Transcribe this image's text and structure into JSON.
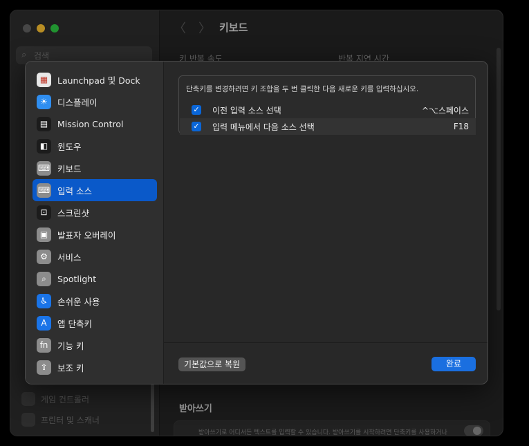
{
  "window": {
    "title": "키보드",
    "search_placeholder": "검색",
    "bg_sidebar_items": [
      "게임 컨트롤러",
      "프린터 및 스캐너"
    ],
    "col_headers": [
      "키 반복 속도",
      "반복 지연 시간"
    ],
    "section_title": "받아쓰기",
    "dictation_desc": "받아쓰기로 어디서든 텍스트를 입력할 수 있습니다. 받아쓰기를 시작하려면 단축키를 사용하거나"
  },
  "sheet": {
    "sidebar": [
      {
        "label": "Launchpad 및 Dock",
        "icon": "launchpad-icon",
        "color": "#e8e8e8",
        "glyph": "▦"
      },
      {
        "label": "디스플레이",
        "icon": "display-icon",
        "color": "#2f8ef0",
        "glyph": "☀"
      },
      {
        "label": "Mission Control",
        "icon": "mission-control-icon",
        "color": "#1c1c1c",
        "glyph": "▤"
      },
      {
        "label": "윈도우",
        "icon": "window-icon",
        "color": "#1c1c1c",
        "glyph": "◧"
      },
      {
        "label": "키보드",
        "icon": "keyboard-icon",
        "color": "#8c8c8c",
        "glyph": "⌨"
      },
      {
        "label": "입력 소스",
        "icon": "input-sources-icon",
        "color": "#8c8c8c",
        "glyph": "⌨"
      },
      {
        "label": "스크린샷",
        "icon": "screenshot-icon",
        "color": "#1c1c1c",
        "glyph": "⊡"
      },
      {
        "label": "발표자 오버레이",
        "icon": "presenter-overlay-icon",
        "color": "#8c8c8c",
        "glyph": "▣"
      },
      {
        "label": "서비스",
        "icon": "services-icon",
        "color": "#8c8c8c",
        "glyph": "⚙"
      },
      {
        "label": "Spotlight",
        "icon": "spotlight-icon",
        "color": "#8c8c8c",
        "glyph": "⌕"
      },
      {
        "label": "손쉬운 사용",
        "icon": "accessibility-icon",
        "color": "#1a74e8",
        "glyph": "♿"
      },
      {
        "label": "앱 단축키",
        "icon": "app-shortcuts-icon",
        "color": "#1a74e8",
        "glyph": "A"
      },
      {
        "label": "기능 키",
        "icon": "function-keys-icon",
        "color": "#8c8c8c",
        "glyph": "fn"
      },
      {
        "label": "보조 키",
        "icon": "modifier-keys-icon",
        "color": "#8c8c8c",
        "glyph": "⇧"
      }
    ],
    "selected_index": 5,
    "instruction": "단축키를 변경하려면 키 조합을 두 번 클릭한 다음 새로운 키를 입력하십시오.",
    "shortcuts": [
      {
        "label": "이전 입력 소스 선택",
        "key": "^⌥스페이스",
        "checked": true
      },
      {
        "label": "입력 메뉴에서 다음 소스 선택",
        "key": "F18",
        "checked": true
      }
    ],
    "restore_label": "기본값으로 복원",
    "done_label": "완료"
  }
}
